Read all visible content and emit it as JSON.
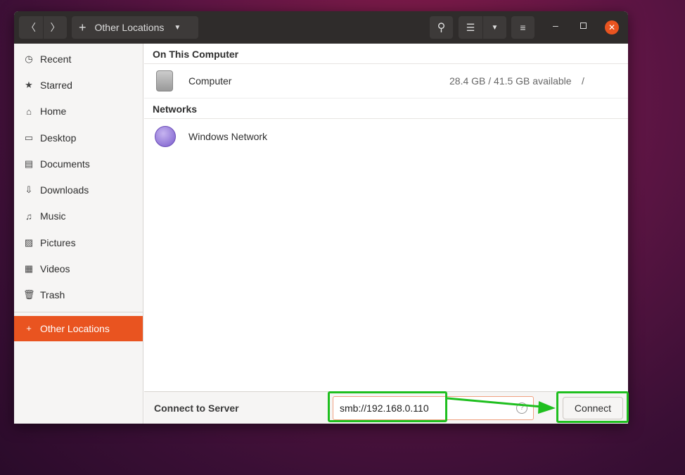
{
  "header": {
    "location": "Other Locations",
    "back": "〈",
    "forward": "〉"
  },
  "sidebar": {
    "items": [
      {
        "label": "Recent",
        "icon": "clock-icon",
        "glyph": "◷"
      },
      {
        "label": "Starred",
        "icon": "star-icon",
        "glyph": "★"
      },
      {
        "label": "Home",
        "icon": "home-icon",
        "glyph": "⌂"
      },
      {
        "label": "Desktop",
        "icon": "desktop-icon",
        "glyph": "▭"
      },
      {
        "label": "Documents",
        "icon": "document-icon",
        "glyph": "▤"
      },
      {
        "label": "Downloads",
        "icon": "download-icon",
        "glyph": "⇩"
      },
      {
        "label": "Music",
        "icon": "music-icon",
        "glyph": "♫"
      },
      {
        "label": "Pictures",
        "icon": "picture-icon",
        "glyph": "▨"
      },
      {
        "label": "Videos",
        "icon": "video-icon",
        "glyph": "▦"
      },
      {
        "label": "Trash",
        "icon": "trash-icon",
        "glyph": "🗑"
      }
    ],
    "other": {
      "label": "Other Locations",
      "glyph": "+"
    }
  },
  "main": {
    "on_this_computer": "On This Computer",
    "computer": {
      "name": "Computer",
      "space": "28.4 GB / 41.5 GB available",
      "mount": "/"
    },
    "networks": "Networks",
    "windows_network": "Windows Network"
  },
  "connect": {
    "label": "Connect to Server",
    "value": "smb://192.168.0.110",
    "button": "Connect"
  },
  "colors": {
    "accent": "#e95420",
    "highlight": "#1fbf1f"
  }
}
